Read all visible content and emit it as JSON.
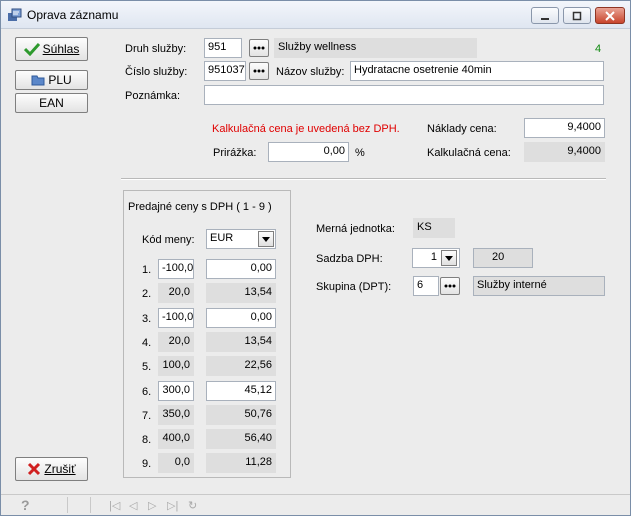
{
  "window": {
    "title": "Oprava záznamu"
  },
  "buttons": {
    "ok": "Súhlas",
    "plu": "PLU",
    "ean": "EAN",
    "cancel": "Zrušiť"
  },
  "form": {
    "druh_label": "Druh služby:",
    "druh_value": "951",
    "druh_name": "Služby wellness",
    "record_count": "4",
    "cislo_label": "Číslo služby:",
    "cislo_value": "951037",
    "nazov_label": "Názov služby:",
    "nazov_value": "Hydratacne osetrenie 40min",
    "poznamka_label": "Poznámka:",
    "poznamka_value": "",
    "warning": "Kalkulačná cena je uvedená bez DPH.",
    "prirazka_label": "Prirážka:",
    "prirazka_value": "0,00",
    "prirazka_unit": "%",
    "naklady_label": "Náklady cena:",
    "naklady_value": "9,4000",
    "kalk_label": "Kalkulačná cena:",
    "kalk_value": "9,4000"
  },
  "prices": {
    "title": "Predajné ceny s DPH ( 1 - 9 )",
    "currency_label": "Kód meny:",
    "currency_value": "EUR",
    "rows": [
      {
        "num": "1.",
        "pct": "-100,0",
        "price": "0,00"
      },
      {
        "num": "2.",
        "pct": "20,0",
        "price": "13,54"
      },
      {
        "num": "3.",
        "pct": "-100,0",
        "price": "0,00"
      },
      {
        "num": "4.",
        "pct": "20,0",
        "price": "13,54"
      },
      {
        "num": "5.",
        "pct": "100,0",
        "price": "22,56"
      },
      {
        "num": "6.",
        "pct": "300,0",
        "price": "45,12"
      },
      {
        "num": "7.",
        "pct": "350,0",
        "price": "50,76"
      },
      {
        "num": "8.",
        "pct": "400,0",
        "price": "56,40"
      },
      {
        "num": "9.",
        "pct": "0,0",
        "price": "11,28"
      }
    ]
  },
  "right": {
    "unit_label": "Merná jednotka:",
    "unit_value": "KS",
    "dph_label": "Sadzba DPH:",
    "dph_value": "1",
    "dph_rate": "20",
    "skupina_label": "Skupina (DPT):",
    "skupina_value": "6",
    "skupina_name": "Služby interné"
  },
  "colors": {
    "warning": "#e00000",
    "count": "#108a10"
  }
}
